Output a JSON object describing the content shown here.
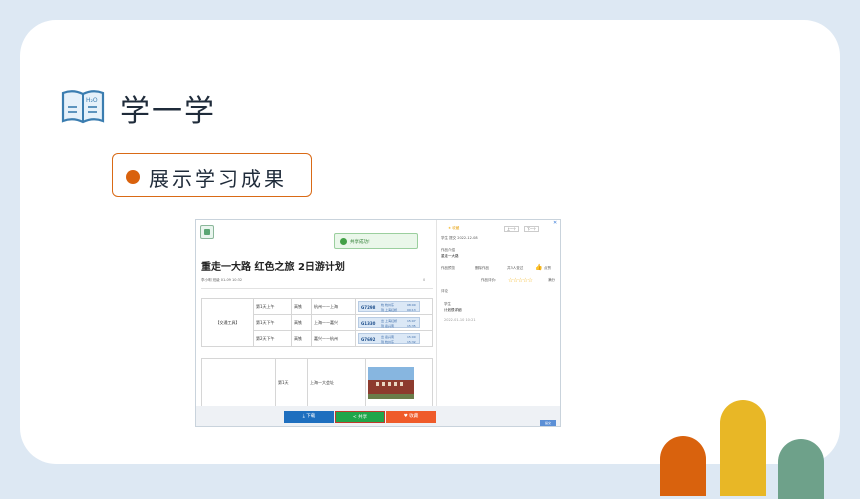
{
  "heading": "学一学",
  "book_icon_label": "H₂O",
  "pill_label": "展示学习成果",
  "screenshot": {
    "toast": "共享成功!",
    "doc_title": "重走一大路 红色之旅 2日游计划",
    "meta": "李小明  班级  01-09 10:32",
    "comment_count": "0",
    "transport_label": "【交通工具】",
    "rows": [
      {
        "time": "第1天上午",
        "mode": "高铁",
        "route": "杭州——上海",
        "code": "G7298",
        "origin": "杭 杭州东",
        "dest": "到 上海虹桥",
        "t1": "08:00",
        "t2": "09:13"
      },
      {
        "time": "第1天下午",
        "mode": "高铁",
        "route": "上海——嘉兴",
        "code": "G1330",
        "origin": "出 上海虹桥",
        "dest": "到 嘉兴南",
        "t1": "15:07",
        "t2": "15:35"
      },
      {
        "time": "第2天下午",
        "mode": "高铁",
        "route": "嘉兴——杭州",
        "code": "G7692",
        "origin": "出 嘉兴南",
        "dest": "到 杭州东",
        "t1": "15:00",
        "t2": "15:32"
      }
    ],
    "day_cell": "第1天",
    "day_route": "上海—大会址",
    "buttons": {
      "download": "下载",
      "share": "共享",
      "favorite": "收藏"
    },
    "send": "提交",
    "right": {
      "fav": "收藏",
      "prev": "上一个",
      "next": "下一个",
      "student_meta": "学生     提交  2022-12-08",
      "work_intro_label": "作品介绍",
      "work_intro_value": "重走一大路",
      "preview": "作品预览",
      "del": "删除作品",
      "visitors": "共3人查过",
      "like": "点赞",
      "rating_label": "作品评价:",
      "rating_hint": "满分",
      "comment_label": "评论",
      "comment_user": "学生",
      "comment_text": "计划很详细",
      "comment_time": "2022-01-10 10:21"
    }
  },
  "colors": {
    "accent_orange": "#d9620d",
    "accent_yellow": "#e8b726",
    "accent_green": "#6ea18a",
    "page_bg": "#dde8f3"
  }
}
